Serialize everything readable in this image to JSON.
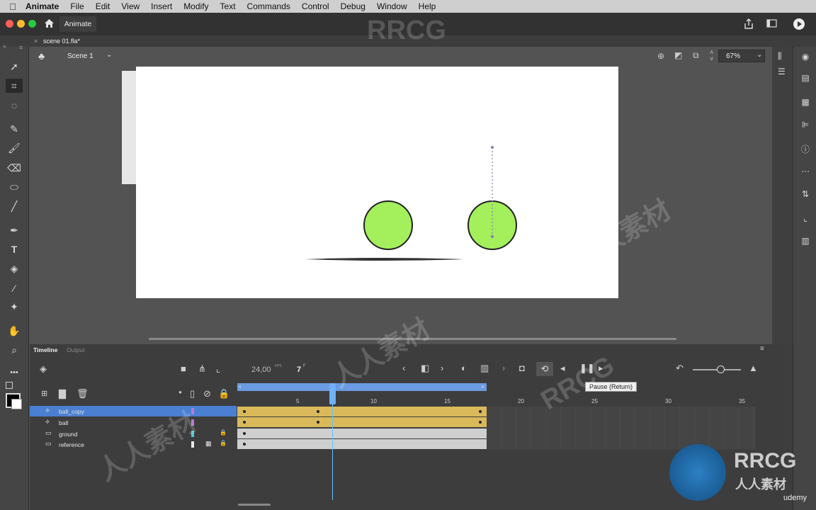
{
  "menubar": {
    "items": [
      "Animate",
      "File",
      "Edit",
      "View",
      "Insert",
      "Modify",
      "Text",
      "Commands",
      "Control",
      "Debug",
      "Window",
      "Help"
    ]
  },
  "appbar": {
    "title": "Animate"
  },
  "document": {
    "tab": "scene 01.fla*"
  },
  "editbar": {
    "scene": "Scene 1",
    "zoom": "67%"
  },
  "timeline": {
    "tabs": [
      "Timeline",
      "Output"
    ],
    "fps": "24,00",
    "fps_unit": "FPS",
    "current_frame": "7",
    "current_frame_unit": "F",
    "tooltip": "Pause (Return)",
    "ruler": [
      "5",
      "10",
      "15",
      "20",
      "25",
      "30",
      "35"
    ],
    "layers": [
      {
        "name": "ball_copy",
        "color": "#b77ad6",
        "selected": true
      },
      {
        "name": "ball",
        "color": "#b77ad6",
        "selected": false
      },
      {
        "name": "ground",
        "color": "#4fc6cf",
        "selected": false
      },
      {
        "name": "reference",
        "color": "#e8e8e8",
        "selected": false
      }
    ]
  },
  "stage": {
    "ball_color": "#a3ef5c",
    "frame_color": "#ffffff"
  },
  "watermark": {
    "main": "RRCG",
    "sub": "人人素材",
    "brand": "udemy"
  }
}
